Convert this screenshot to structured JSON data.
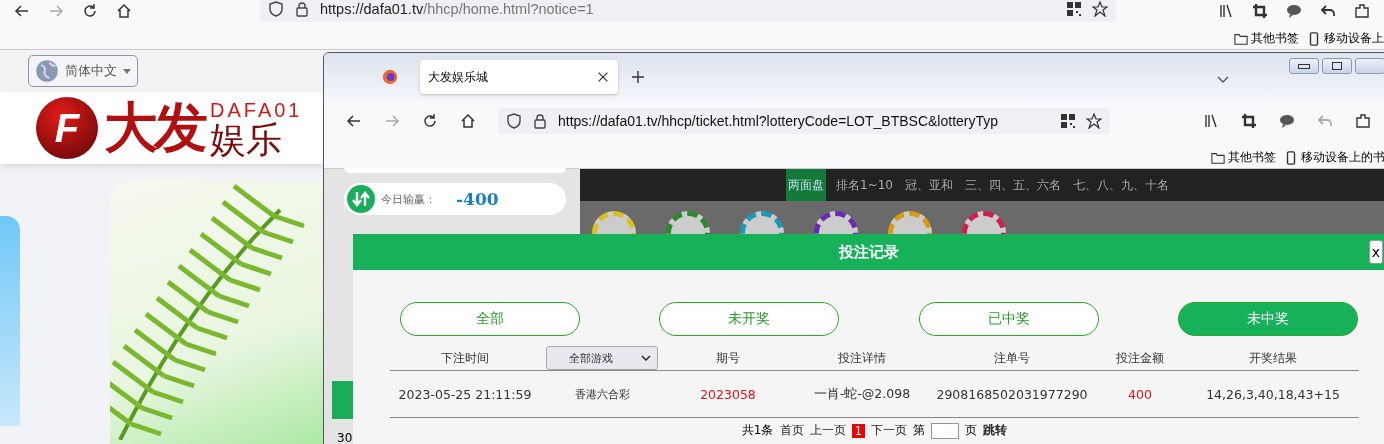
{
  "back_window": {
    "url_host": "https://dafa01.tv",
    "url_path": "/hhcp/home.html?notice=1",
    "bookmarks": [
      "其他书签",
      "移动设备上"
    ],
    "language": "简体中文",
    "logo": {
      "mark": "F",
      "name": "大发",
      "latin": "DAFA01",
      "sub": "娱乐"
    }
  },
  "front_window": {
    "tab_title": "大发娱乐城",
    "url_host": "https://dafa01.tv",
    "url_path": "/hhcp/ticket.html?lotteryCode=LOT_BTBSC&lotteryTyp",
    "bookmarks": [
      "其他书签",
      "移动设备上的书"
    ],
    "sidebar": {
      "label": "今日输赢：",
      "value": "-400",
      "footer": "30"
    },
    "game_tabs": [
      {
        "label": "两面盘",
        "selected": true
      },
      {
        "label": "排名1~10",
        "selected": false
      },
      {
        "label": "冠、亚和",
        "selected": false
      },
      {
        "label": "三、四、五、六名",
        "selected": false
      },
      {
        "label": "七、八、九、十名",
        "selected": false
      }
    ],
    "chips": [
      {
        "color": "#d8c020"
      },
      {
        "color": "#2a8a2a"
      },
      {
        "color": "#1a9ab8"
      },
      {
        "color": "#6a2ab0"
      },
      {
        "color": "#d89a10"
      },
      {
        "color": "#d0204a"
      }
    ]
  },
  "dialog": {
    "title": "投注记录",
    "close": "x",
    "filters": [
      {
        "label": "全部",
        "selected": false
      },
      {
        "label": "未开奖",
        "selected": false
      },
      {
        "label": "已中奖",
        "selected": false
      },
      {
        "label": "未中奖",
        "selected": true
      }
    ],
    "game_select": "全部游戏",
    "columns": [
      "下注时间",
      "期号",
      "投注详情",
      "注单号",
      "投注金额",
      "开奖结果"
    ],
    "rows": [
      {
        "time": "2023-05-25 21:11:59",
        "game": "香港六合彩",
        "issue": "2023058",
        "detail": "一肖-蛇-@2.098",
        "order": "2908168502031977290",
        "amount": "400",
        "result": "14,26,3,40,18,43+15"
      }
    ],
    "pager": {
      "total": "共1条",
      "first": "首页",
      "prev": "上一页",
      "current": "1",
      "next": "下一页",
      "goto_prefix": "第",
      "goto_suffix": "页",
      "goto": "跳转"
    }
  }
}
